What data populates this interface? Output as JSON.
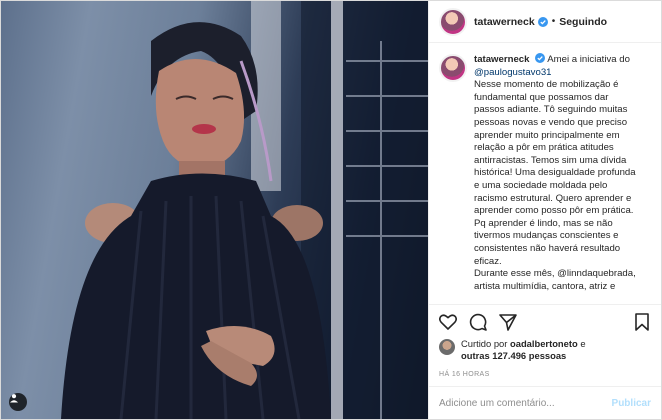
{
  "header": {
    "username": "tatawerneck",
    "separator": "•",
    "follow_label": "Seguindo"
  },
  "caption": {
    "username": "tatawerneck",
    "lines": [
      "Amei a iniciativa do",
      "@paulogustavo31",
      "Nesse momento de mobilização é",
      "fundamental que possamos dar",
      "passos adiante. Tô seguindo muitas",
      "pessoas novas e vendo que preciso",
      "aprender muito principalmente em",
      "relação a pôr em prática atitudes",
      "antirracistas. Temos sim uma dívida",
      "histórica! Uma desigualdade profunda",
      "e uma sociedade moldada pelo",
      "racismo estrutural. Quero aprender e",
      "aprender como posso pôr em prática.",
      "Pq aprender é lindo, mas se não",
      "tivermos mudanças conscientes e",
      "consistentes não haverá resultado",
      "eficaz.",
      "Durante esse mês, @linndaquebrada,",
      "artista multimídia, cantora, atriz e"
    ]
  },
  "likes": {
    "prefix": "Curtido por",
    "liker": "oadalbertoneto",
    "connector": "e",
    "others": "outras 127.496 pessoas"
  },
  "timestamp": "HÁ 16 HORAS",
  "comment": {
    "placeholder": "Adicione um comentário...",
    "post_label": "Publicar"
  },
  "colors": {
    "verified": "#3897f0",
    "mention": "#00376b",
    "post_disabled": "#b2dffc"
  },
  "icons": [
    "heart-icon",
    "comment-icon",
    "share-icon",
    "bookmark-icon",
    "verified-badge-icon",
    "user-tag-icon"
  ]
}
